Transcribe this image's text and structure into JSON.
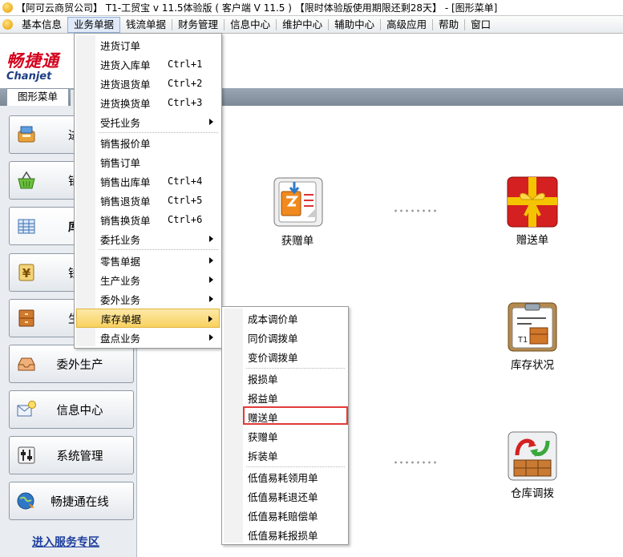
{
  "window": {
    "title": "【阿可云商贸公司】 T1-工贸宝 v 11.5体验版 ( 客户端 V 11.5 ) 【限时体验版使用期限还剩28天】 - [图形菜单]"
  },
  "menubar": {
    "items": [
      "基本信息",
      "业务单据",
      "钱流单据",
      "财务管理",
      "信息中心",
      "维护中心",
      "辅助中心",
      "高级应用",
      "帮助",
      "窗口"
    ]
  },
  "logo": {
    "cn": "畅捷通",
    "en": "Chanjet"
  },
  "tabs": {
    "active": "图形菜单"
  },
  "sidebar": {
    "items": [
      "进货",
      "销售",
      "库存",
      "钱流",
      "生产",
      "委外生产",
      "信息中心",
      "系统管理",
      "畅捷通在线"
    ],
    "service_link": "进入服务专区"
  },
  "graph": {
    "nodes": [
      "获赠单",
      "赠送单",
      "库存状况",
      "仓库调拨"
    ]
  },
  "business_menu": {
    "items": [
      {
        "label": "进货订单",
        "shortcut": ""
      },
      {
        "label": "进货入库单",
        "shortcut": "Ctrl+1"
      },
      {
        "label": "进货退货单",
        "shortcut": "Ctrl+2"
      },
      {
        "label": "进货换货单",
        "shortcut": "Ctrl+3"
      },
      {
        "label": "受托业务",
        "shortcut": ""
      },
      {
        "label": "销售报价单",
        "shortcut": ""
      },
      {
        "label": "销售订单",
        "shortcut": ""
      },
      {
        "label": "销售出库单",
        "shortcut": "Ctrl+4"
      },
      {
        "label": "销售退货单",
        "shortcut": "Ctrl+5"
      },
      {
        "label": "销售换货单",
        "shortcut": "Ctrl+6"
      },
      {
        "label": "委托业务",
        "shortcut": ""
      },
      {
        "label": "零售单据",
        "shortcut": ""
      },
      {
        "label": "生产业务",
        "shortcut": ""
      },
      {
        "label": "委外业务",
        "shortcut": ""
      },
      {
        "label": "库存单据",
        "shortcut": ""
      },
      {
        "label": "盘点业务",
        "shortcut": ""
      }
    ]
  },
  "inventory_submenu": {
    "items": [
      "成本调价单",
      "同价调拨单",
      "变价调拨单",
      "报损单",
      "报益单",
      "赠送单",
      "获赠单",
      "拆装单",
      "低值易耗领用单",
      "低值易耗退还单",
      "低值易耗赔偿单",
      "低值易耗报损单"
    ]
  },
  "colors": {
    "highlight": "#f8d15f",
    "annotation": "#e23a3a",
    "logo_red": "#d4001c",
    "link_blue": "#1d3e9e"
  }
}
